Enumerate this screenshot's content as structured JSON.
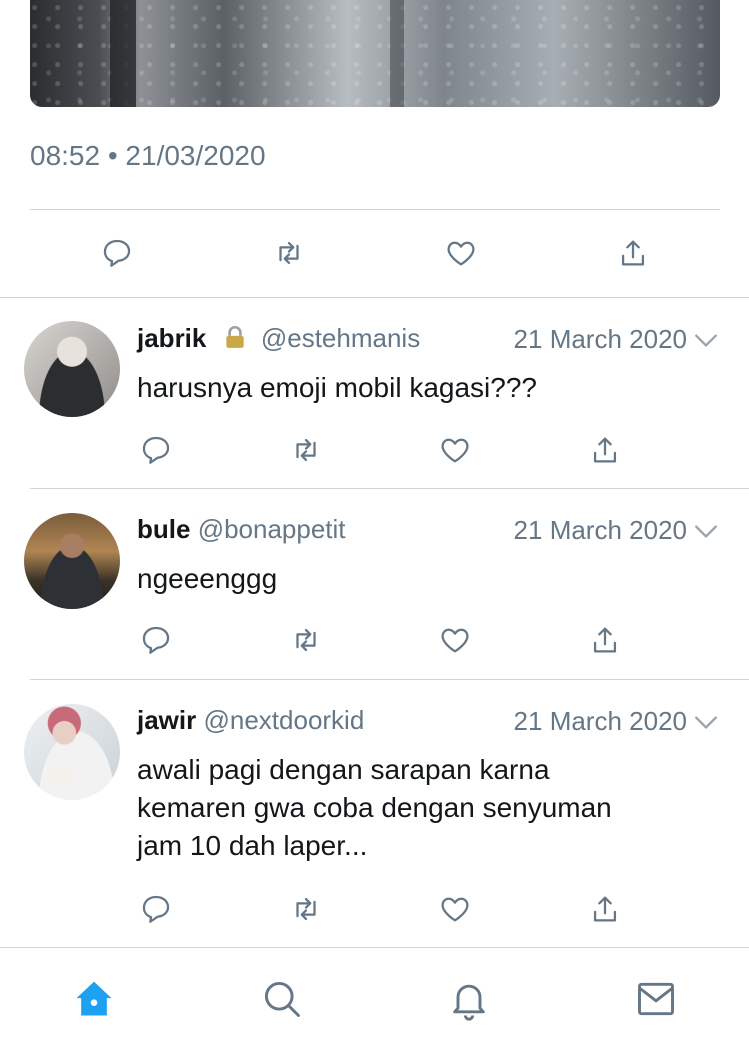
{
  "detail": {
    "timestamp": "08:52 • 21/03/2020",
    "actions": [
      "reply-icon",
      "retweet-icon",
      "like-icon",
      "share-icon"
    ]
  },
  "replies": [
    {
      "display_name": "jabrik",
      "protected": true,
      "handle": "@estehmanis",
      "date": "21 March 2020",
      "text_lines": [
        "harusnya emoji mobil kagasi???"
      ]
    },
    {
      "display_name": "bule",
      "protected": false,
      "handle": "@bonappetit",
      "date": "21 March 2020",
      "text_lines": [
        "ngeeenggg"
      ]
    },
    {
      "display_name": "jawir",
      "protected": false,
      "handle": "@nextdoorkid",
      "date": "21 March 2020",
      "text_lines": [
        "awali pagi dengan sarapan karna",
        "kemaren gwa coba dengan senyuman",
        "jam 10 dah laper..."
      ]
    }
  ],
  "tabbar": {
    "items": [
      "home-icon",
      "search-icon",
      "notifications-icon",
      "messages-icon"
    ],
    "active": "home-icon",
    "accent_color": "#1da1f2",
    "icon_color": "#657786"
  }
}
